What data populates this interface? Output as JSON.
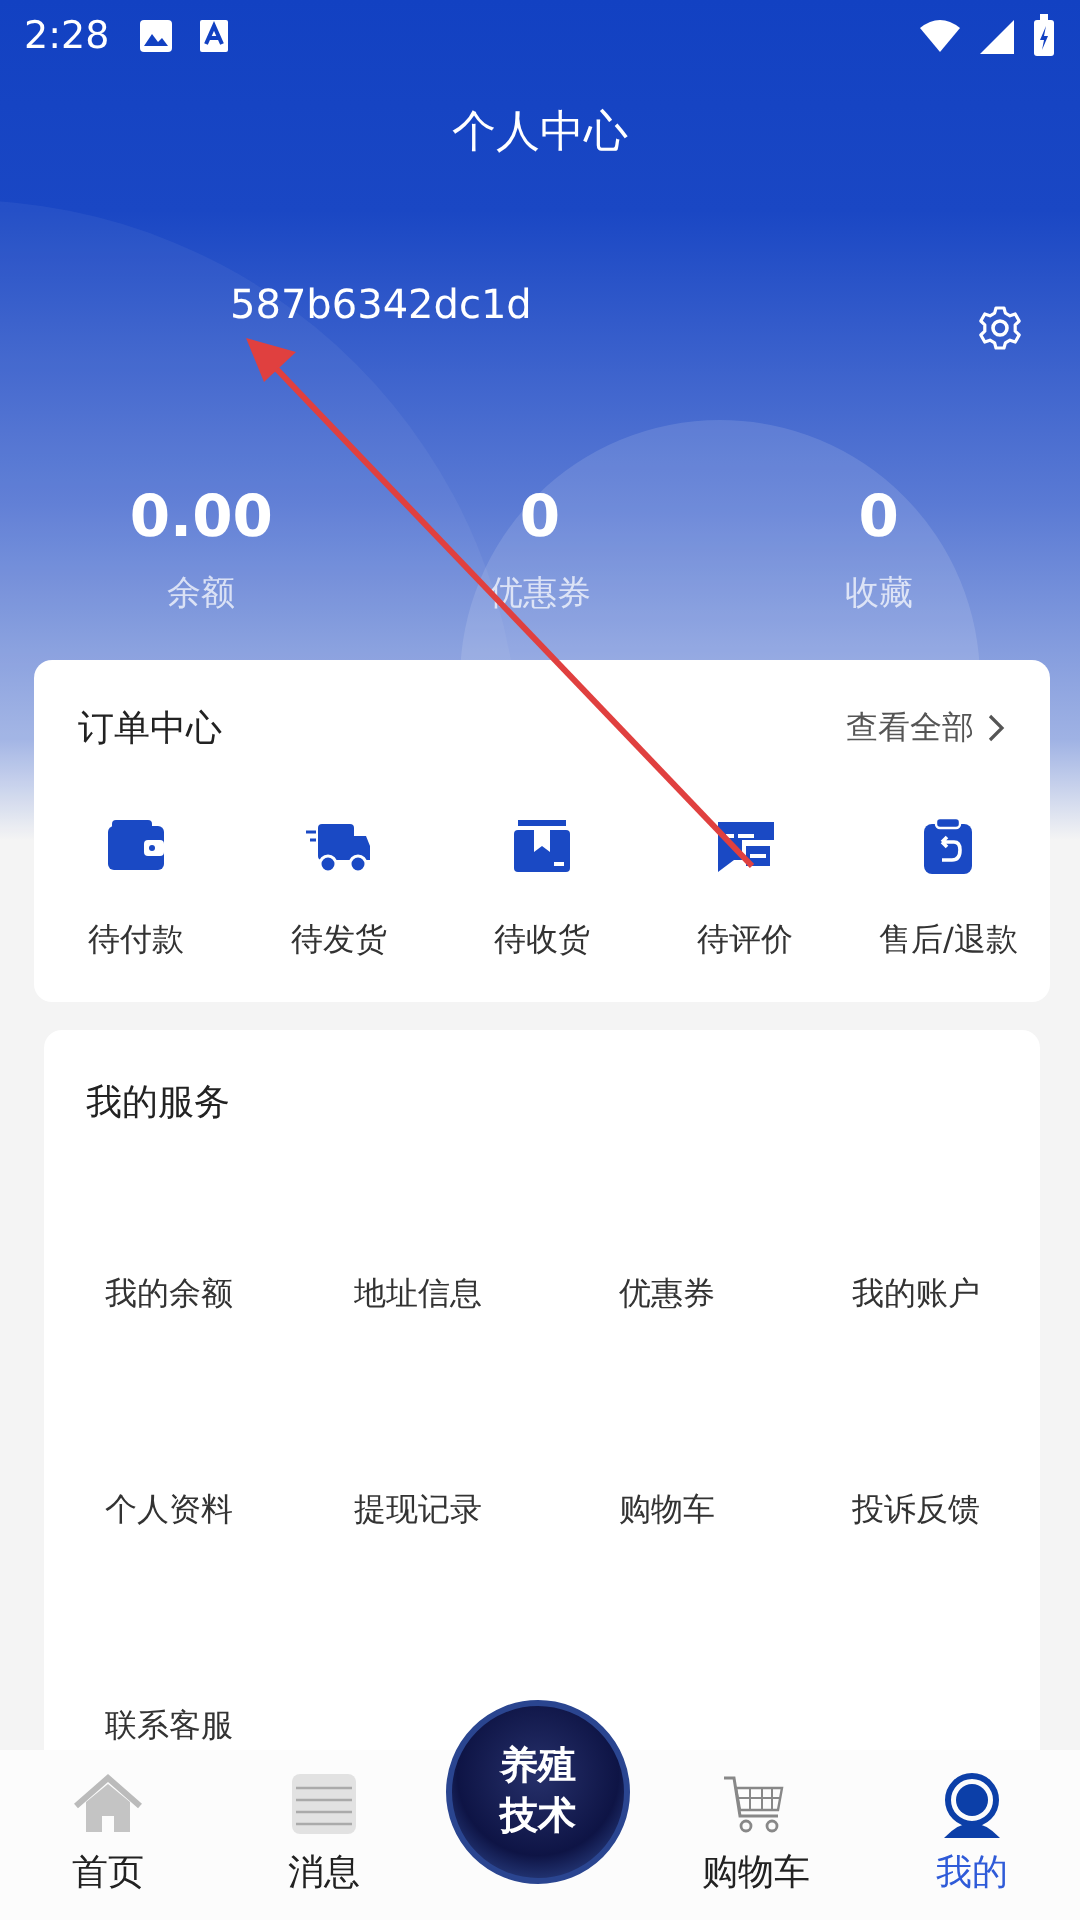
{
  "status_bar": {
    "time": "2:28"
  },
  "title": "个人中心",
  "user": {
    "name": "587b6342dc1d"
  },
  "stats": [
    {
      "value": "0.00",
      "label": "余额"
    },
    {
      "value": "0",
      "label": "优惠券"
    },
    {
      "value": "0",
      "label": "收藏"
    }
  ],
  "order_center": {
    "title": "订单中心",
    "view_all": "查看全部",
    "items": [
      {
        "label": "待付款",
        "kind": "wallet"
      },
      {
        "label": "待发货",
        "kind": "truck"
      },
      {
        "label": "待收货",
        "kind": "box"
      },
      {
        "label": "待评价",
        "kind": "chat"
      },
      {
        "label": "售后/退款",
        "kind": "refund"
      }
    ]
  },
  "services": {
    "title": "我的服务",
    "items": [
      "我的余额",
      "地址信息",
      "优惠券",
      "我的账户",
      "个人资料",
      "提现记录",
      "购物车",
      "投诉反馈",
      "联系客服"
    ]
  },
  "nav": [
    {
      "label": "首页",
      "kind": "home",
      "selected": false
    },
    {
      "label": "消息",
      "kind": "message",
      "selected": false
    },
    {
      "label": "养殖技术",
      "kind": "center",
      "selected": false
    },
    {
      "label": "购物车",
      "kind": "cart",
      "selected": false
    },
    {
      "label": "我的",
      "kind": "profile",
      "selected": true
    }
  ]
}
